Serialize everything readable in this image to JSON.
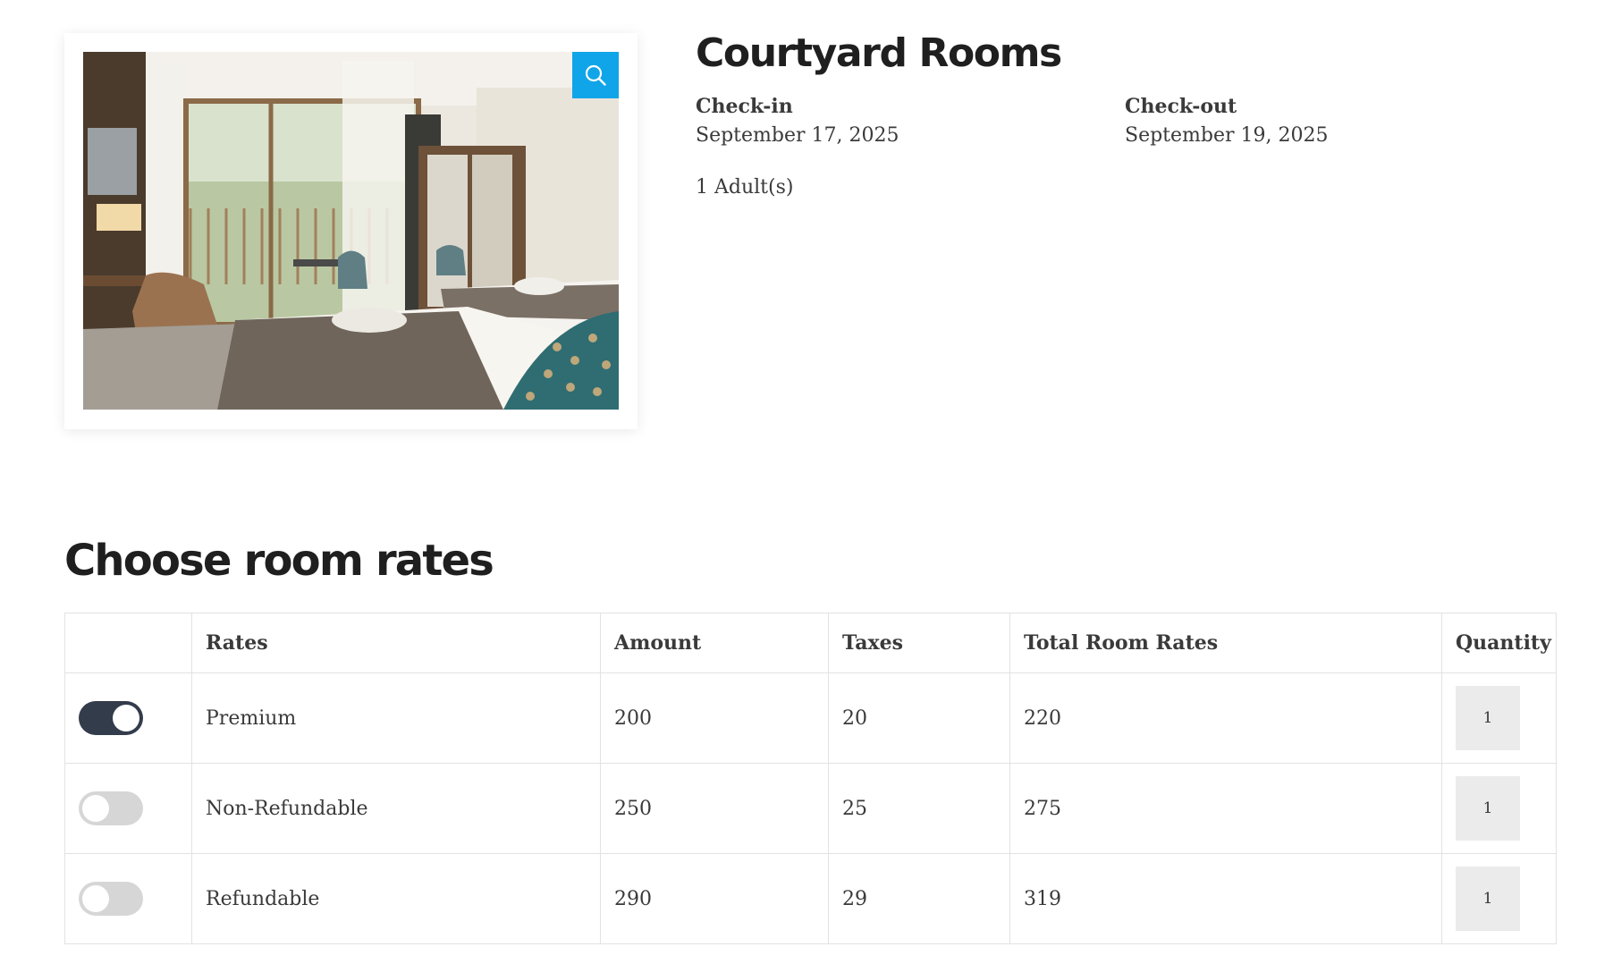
{
  "room": {
    "title": "Courtyard Rooms",
    "image_alt": "Hotel room with twin beds, armchairs and balcony",
    "zoom_icon": "magnifier-icon",
    "checkin_label": "Check-in",
    "checkin_date": "September 17, 2025",
    "checkout_label": "Check-out",
    "checkout_date": "September 19, 2025",
    "guests": "1 Adult(s)"
  },
  "rates": {
    "heading": "Choose room rates",
    "columns": {
      "select": "",
      "rate": "Rates",
      "amount": "Amount",
      "taxes": "Taxes",
      "total": "Total Room Rates",
      "quantity": "Quantity"
    },
    "rows": [
      {
        "selected": true,
        "name": "Premium",
        "amount": "200",
        "taxes": "20",
        "total": "220",
        "quantity": "1"
      },
      {
        "selected": false,
        "name": "Non-Refundable",
        "amount": "250",
        "taxes": "25",
        "total": "275",
        "quantity": "1"
      },
      {
        "selected": false,
        "name": "Refundable",
        "amount": "290",
        "taxes": "29",
        "total": "319",
        "quantity": "1"
      }
    ]
  },
  "colors": {
    "accent": "#10a5e8",
    "toggle_on": "#333c4b",
    "toggle_off": "#d6d6d6",
    "quantity_bg": "#ebebeb"
  }
}
